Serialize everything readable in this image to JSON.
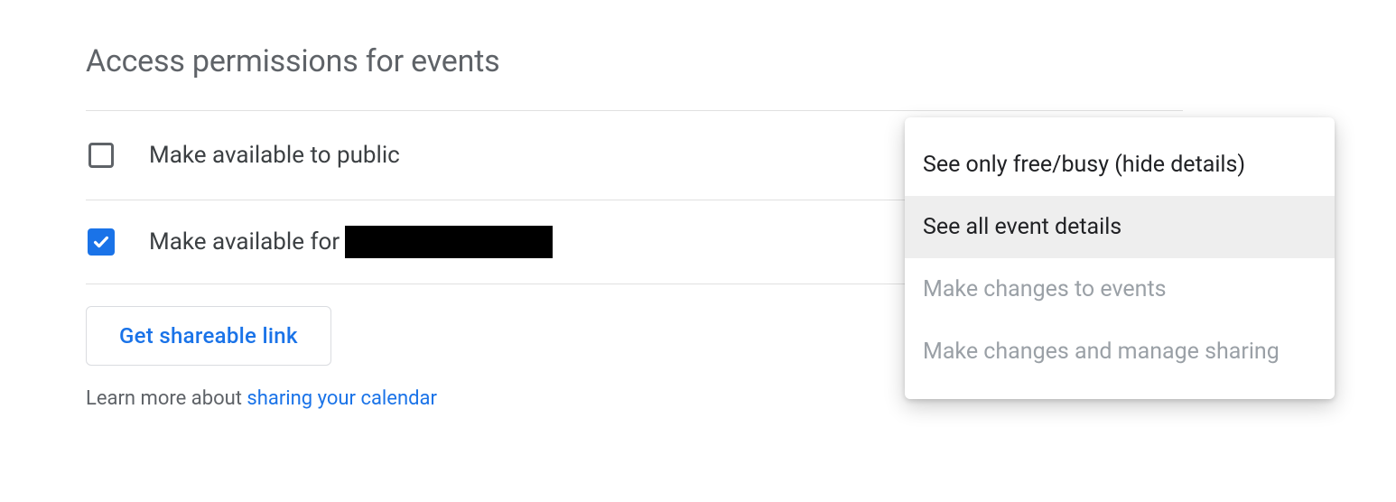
{
  "section": {
    "title": "Access permissions for events"
  },
  "options": {
    "public": {
      "label": "Make available to public",
      "checked": false
    },
    "org": {
      "label_prefix": "Make available for ",
      "checked": true
    }
  },
  "button": {
    "shareable_link": "Get shareable link"
  },
  "learn_more": {
    "prefix": "Learn more about ",
    "link_text": "sharing your calendar"
  },
  "dropdown": {
    "items": [
      {
        "label": "See only free/busy (hide details)",
        "state": "enabled"
      },
      {
        "label": "See all event details",
        "state": "selected"
      },
      {
        "label": "Make changes to events",
        "state": "disabled"
      },
      {
        "label": "Make changes and manage sharing",
        "state": "disabled"
      }
    ]
  }
}
